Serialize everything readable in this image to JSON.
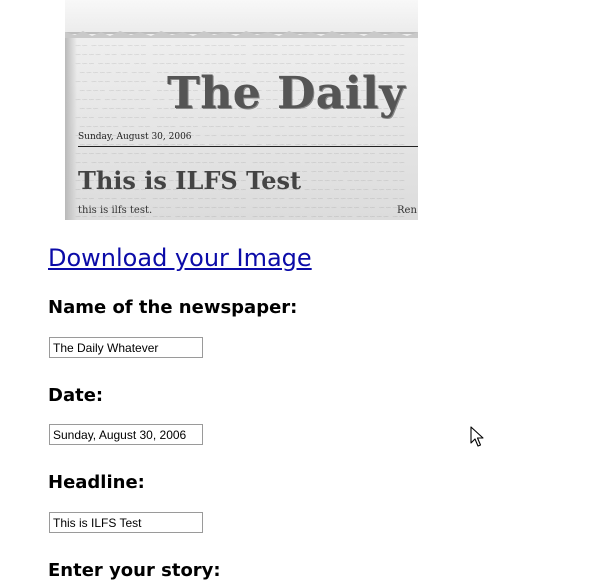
{
  "newspaper_preview": {
    "title": "The Daily W",
    "date": "Sunday, August 30, 2006",
    "headline": "This is ILFS Test",
    "story": "this is ilfs test.",
    "partial_word": "Ren"
  },
  "download_link": "Download your Image",
  "form": {
    "name_label": "Name of the newspaper:",
    "name_value": "The Daily Whatever",
    "date_label": "Date:",
    "date_value": "Sunday, August 30, 2006",
    "headline_label": "Headline:",
    "headline_value": "This is ILFS Test",
    "story_label": "Enter your story:"
  },
  "colors": {
    "link": "#0b0ba8",
    "input_border": "#9a9a9a",
    "paper": "#e7e7e7"
  },
  "icons": {
    "cursor": "mouse-pointer-icon"
  }
}
